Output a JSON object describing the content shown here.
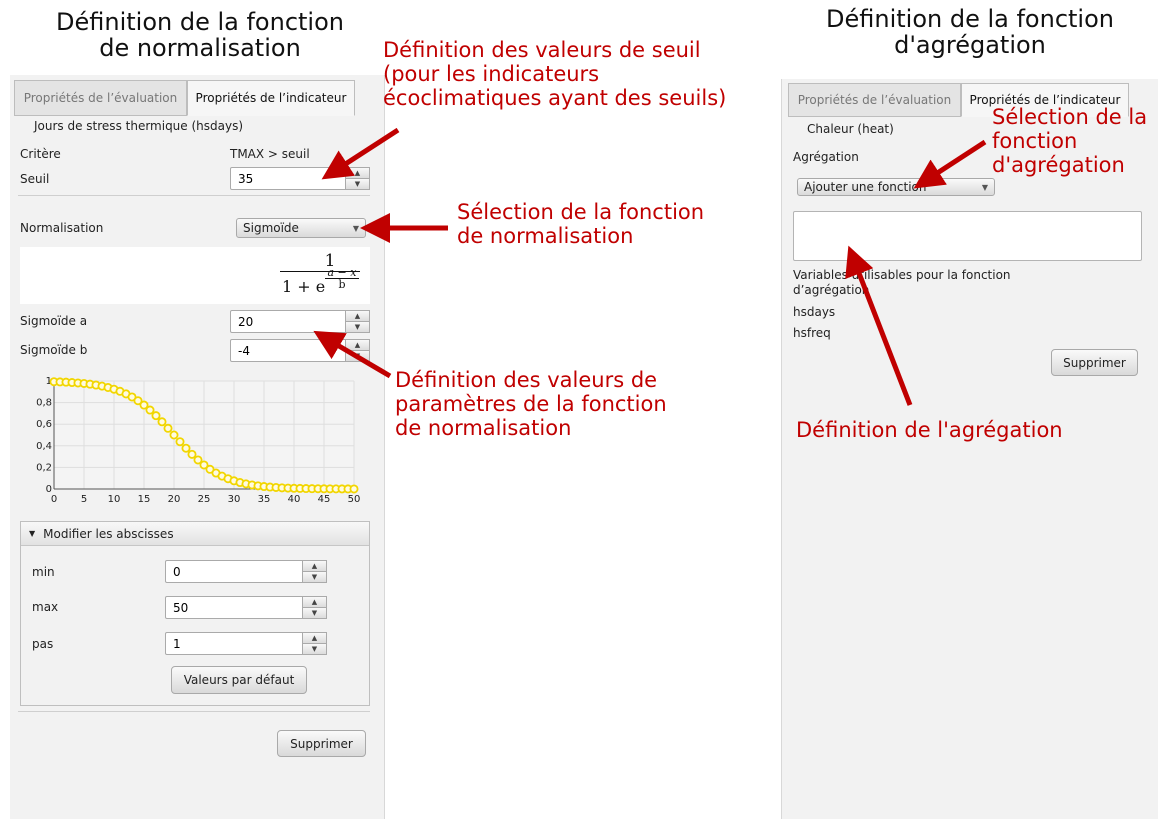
{
  "titles": {
    "left_line1": "Définition de la fonction",
    "left_line2": "de normalisation",
    "right_line1": "Définition de la fonction",
    "right_line2": "d'agrégation"
  },
  "annotations": {
    "seuil": "Définition des valeurs de seuil\n(pour les indicateurs\nécoclimatiques ayant des seuils)",
    "normalisation": "Sélection de la fonction\nde normalisation",
    "parametres": "Définition des valeurs de\nparamètres de la fonction\nde normalisation",
    "agregation_select": "Sélection de la\nfonction\nd'agrégation",
    "agregation_def": "Définition de l'agrégation"
  },
  "left_panel": {
    "tabs": [
      "Propriétés de l’évaluation",
      "Propriétés de l’indicateur"
    ],
    "indicator_name": "Jours de stress thermique (hsdays)",
    "critere_label": "Critère",
    "critere_value": "TMAX > seuil",
    "seuil_label": "Seuil",
    "seuil_value": "35",
    "normalisation_label": "Normalisation",
    "normalisation_value": "Sigmoïde",
    "formula": {
      "num": "1",
      "den_base": "1 + e",
      "exp_num": "a − x",
      "exp_den": "b"
    },
    "sigmoide_a_label": "Sigmoïde a",
    "sigmoide_a_value": "20",
    "sigmoide_b_label": "Sigmoïde b",
    "sigmoide_b_value": "-4",
    "abscisses": {
      "header": "Modifier les abscisses",
      "min_label": "min",
      "min_value": "0",
      "max_label": "max",
      "max_value": "50",
      "pas_label": "pas",
      "pas_value": "1",
      "default_button": "Valeurs par défaut"
    },
    "delete_button": "Supprimer"
  },
  "right_panel": {
    "tabs": [
      "Propriétés de l’évaluation",
      "Propriétés de l’indicateur"
    ],
    "indicator_name": "Chaleur (heat)",
    "aggregation_label": "Agrégation",
    "aggregation_combo": "Ajouter une fonction",
    "aggregation_expression": "",
    "variables_label": "Variables utilisables pour la fonction d’agrégation",
    "variables": [
      "hsdays",
      "hsfreq"
    ],
    "delete_button": "Supprimer"
  },
  "colors": {
    "annotation": "#c00000",
    "curve": "#f2d600",
    "panel": "#f2f2f2"
  },
  "chart_data": {
    "type": "scatter",
    "title": "",
    "xlabel": "",
    "ylabel": "",
    "xlim": [
      0,
      50
    ],
    "ylim": [
      0,
      1
    ],
    "x_ticks": [
      "0",
      "5",
      "10",
      "15",
      "20",
      "25",
      "30",
      "35",
      "40",
      "45",
      "50"
    ],
    "y_ticks": [
      "0",
      "0,2",
      "0,4",
      "0,6",
      "0,8",
      "1"
    ],
    "grid": true,
    "function": "sigmoid",
    "params": {
      "a": 20,
      "b": -4
    },
    "x_range": [
      0,
      50,
      1
    ]
  }
}
